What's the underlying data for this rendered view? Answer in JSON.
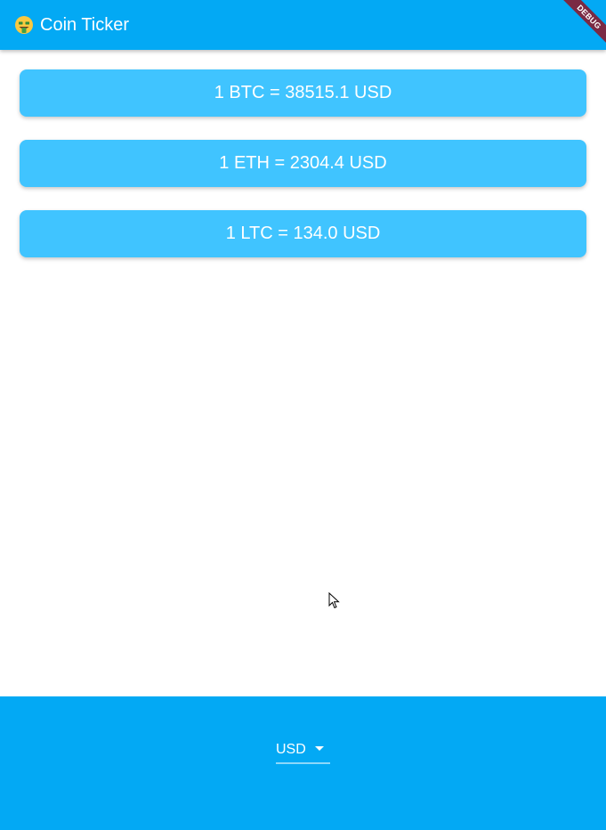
{
  "app_bar": {
    "emoji_icon": "money-mouth-face-icon",
    "title": "Coin Ticker",
    "debug_banner": "DEBUG"
  },
  "rates": [
    {
      "text": "1 BTC = 38515.1 USD"
    },
    {
      "text": "1 ETH = 2304.4 USD"
    },
    {
      "text": "1 LTC = 134.0 USD"
    }
  ],
  "currency_dropdown": {
    "selected": "USD",
    "icon": "arrow-drop-down-icon"
  },
  "colors": {
    "primary": "#03a9f4",
    "card": "#40c4ff",
    "text_on_primary": "#ffffff",
    "debug_banner": "#7a2a44"
  }
}
